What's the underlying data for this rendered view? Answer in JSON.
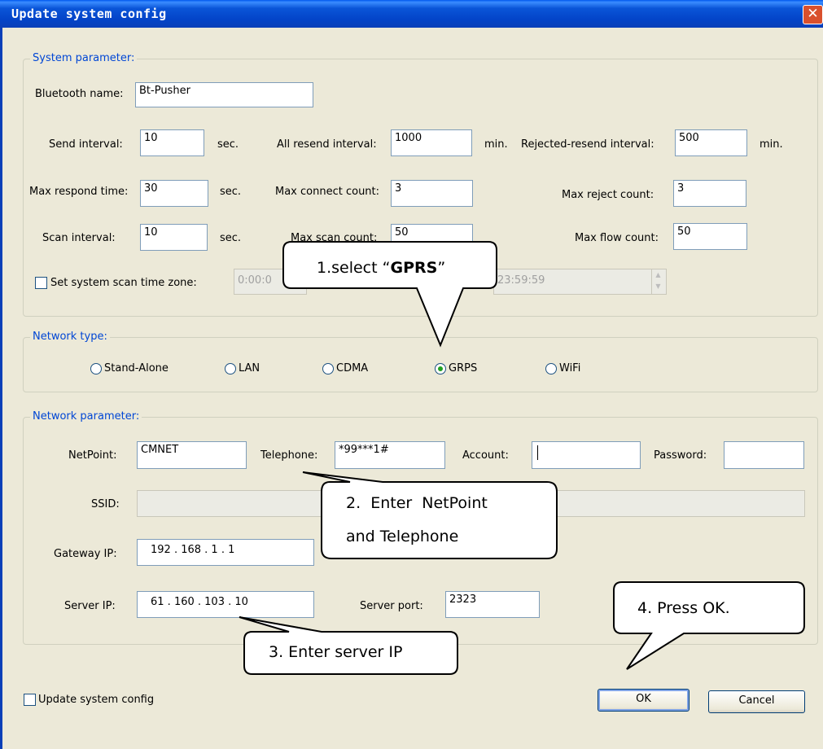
{
  "window": {
    "title": "Update system config",
    "close_glyph": "✕"
  },
  "system_param": {
    "legend": "System parameter:",
    "bluetooth_name_label": "Bluetooth name:",
    "bluetooth_name_value": "Bt-Pusher",
    "send_interval_label": "Send interval:",
    "send_interval_value": "10",
    "send_interval_unit": "sec.",
    "all_resend_label": "All resend interval:",
    "all_resend_value": "1000",
    "all_resend_unit": "min.",
    "rejected_resend_label": "Rejected-resend interval:",
    "rejected_resend_value": "500",
    "rejected_resend_unit": "min.",
    "max_respond_label": "Max respond time:",
    "max_respond_value": "30",
    "max_respond_unit": "sec.",
    "max_connect_label": "Max connect count:",
    "max_connect_value": "3",
    "max_reject_label": "Max reject count:",
    "max_reject_value": "3",
    "scan_interval_label": "Scan interval:",
    "scan_interval_value": "10",
    "scan_interval_unit": "sec.",
    "max_scan_label": "Max scan count:",
    "max_scan_value": "50",
    "max_flow_label": "Max flow count:",
    "max_flow_value": "50",
    "scan_zone_label": "Set system scan time zone:",
    "scan_zone_start": "0:00:0",
    "scan_zone_end": "23:59:59"
  },
  "network_type": {
    "legend": "Network type:",
    "options": [
      "Stand-Alone",
      "LAN",
      "CDMA",
      "GRPS",
      "WiFi"
    ],
    "selected": "GRPS"
  },
  "network_param": {
    "legend": "Network parameter:",
    "netpoint_label": "NetPoint:",
    "netpoint_value": "CMNET",
    "telephone_label": "Telephone:",
    "telephone_value": "*99***1#",
    "account_label": "Account:",
    "account_value": "",
    "password_label": "Password:",
    "password_value": "",
    "ssid_label": "SSID:",
    "ssid_value": "",
    "gateway_label": "Gateway IP:",
    "gateway_value": "192 . 168 . 1 . 1",
    "server_ip_label": "Server IP:",
    "server_ip_value": "61 . 160 . 103 . 10",
    "server_port_label": "Server port:",
    "server_port_value": "2323"
  },
  "footer": {
    "update_checkbox_label": "Update system config",
    "ok_label": "OK",
    "cancel_label": "Cancel"
  },
  "callouts": {
    "c1_prefix": "1.select “",
    "c1_bold": "GPRS",
    "c1_suffix": "”",
    "c2_line1": "2.  Enter  NetPoint",
    "c2_line2": "and Telephone",
    "c3": "3. Enter server IP",
    "c4": "4. Press OK."
  }
}
